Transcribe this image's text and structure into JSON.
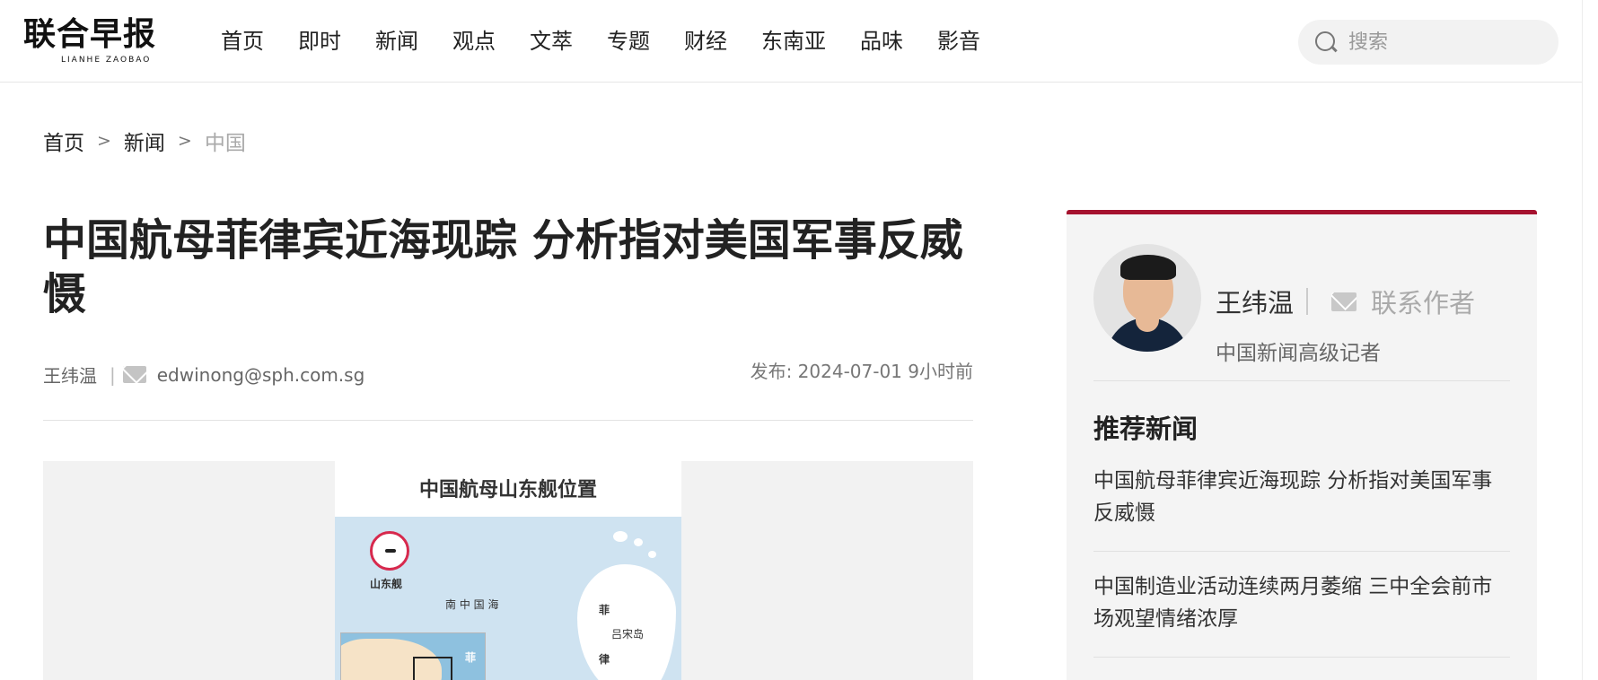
{
  "header": {
    "logo_cn": "联合早报",
    "logo_en": "LIANHE ZAOBAO",
    "nav": [
      "首页",
      "即时",
      "新闻",
      "观点",
      "文萃",
      "专题",
      "财经",
      "东南亚",
      "品味",
      "影音"
    ],
    "search_placeholder": "搜索"
  },
  "breadcrumb": {
    "items": [
      "首页",
      "新闻"
    ],
    "separator": ">",
    "current": "中国"
  },
  "article": {
    "title": "中国航母菲律宾近海现踪 分析指对美国军事反威慑",
    "author": "王纬温",
    "separator": "|",
    "email": "edwinong@sph.com.sg",
    "date": "发布: 2024-07-01 9小时前",
    "map": {
      "title": "中国航母山东舰位置",
      "ship_label": "山东舰",
      "sea_label": "南 中 国 海",
      "phil_char_1": "菲",
      "phil_char_2": "律",
      "luzon_label": "吕宋岛",
      "inset_label": "菲"
    }
  },
  "sidebar": {
    "author_name": "王纬温",
    "contact_label": "联系作者",
    "role": "中国新闻高级记者",
    "recommended_heading": "推荐新闻",
    "news": [
      "中国航母菲律宾近海现踪 分析指对美国军事反威慑",
      "中国制造业活动连续两月萎缩 三中全会前市场观望情绪浓厚"
    ]
  },
  "colors": {
    "accent": "#a5122e",
    "logo_red": "#c8102e",
    "sidebar_bg": "#f4f4f4",
    "sea": "#cfe3f1"
  }
}
